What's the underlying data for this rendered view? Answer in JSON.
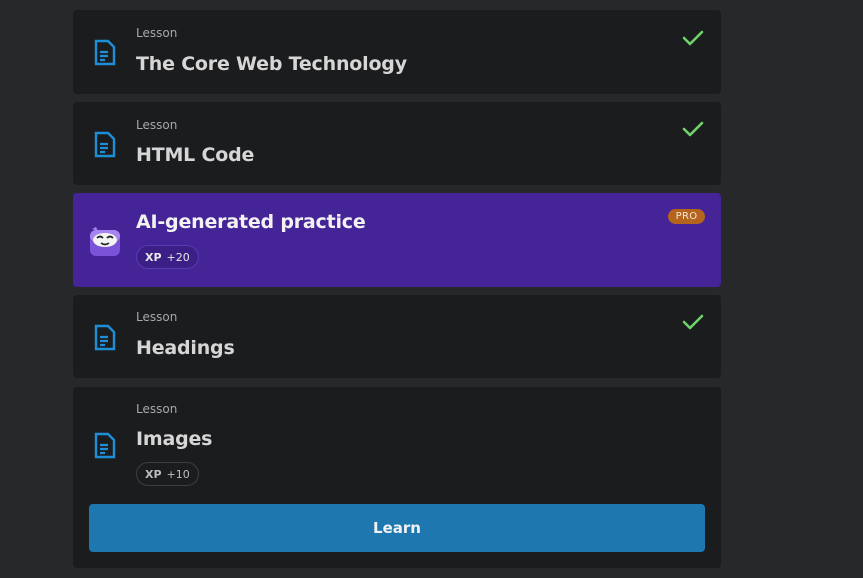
{
  "lessons": [
    {
      "kicker": "Lesson",
      "title": "The Core Web Technology",
      "completed": true
    },
    {
      "kicker": "Lesson",
      "title": "HTML Code",
      "completed": true
    },
    {
      "kicker": "Lesson",
      "title": "Headings",
      "completed": true
    },
    {
      "kicker": "Lesson",
      "title": "Images",
      "completed": false,
      "xp_label": "XP",
      "xp_value": "+10"
    }
  ],
  "ai_practice": {
    "title": "AI-generated practice",
    "badge": "PRO",
    "xp_label": "XP",
    "xp_value": "+20"
  },
  "learn_button": "Learn",
  "icons": {
    "lesson": "document-icon",
    "completed": "check-icon",
    "ai": "mascot-icon"
  },
  "colors": {
    "background": "#27282a",
    "card": "#1b1c1e",
    "ai_card": "#442497",
    "pro_badge": "#b5641e",
    "check": "#6fd36a",
    "doc_icon": "#1e8fd6",
    "learn_button": "#1e77ae"
  }
}
